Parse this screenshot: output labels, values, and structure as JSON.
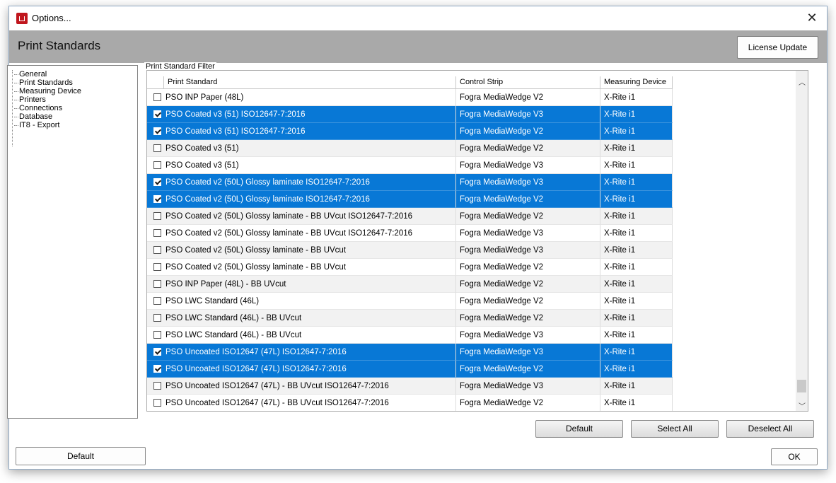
{
  "window": {
    "title": "Options...",
    "close_glyph": "✕"
  },
  "header": {
    "title": "Print Standards",
    "license_button": "License Update"
  },
  "tree": {
    "items": [
      "General",
      "Print Standards",
      "Measuring Device",
      "Printers",
      "Connections",
      "Database",
      "IT8 - Export"
    ]
  },
  "filter": {
    "legend": "Print Standard Filter",
    "columns": {
      "standard": "Print Standard",
      "strip": "Control Strip",
      "device": "Measuring Device"
    },
    "rows": [
      {
        "checked": false,
        "selected": false,
        "standard": "PSO INP Paper (48L)",
        "strip": "Fogra MediaWedge V2",
        "device": "X-Rite i1"
      },
      {
        "checked": true,
        "selected": true,
        "standard": "PSO Coated v3 (51) ISO12647-7:2016",
        "strip": "Fogra MediaWedge V3",
        "device": "X-Rite i1"
      },
      {
        "checked": true,
        "selected": true,
        "standard": "PSO Coated v3 (51) ISO12647-7:2016",
        "strip": "Fogra MediaWedge V2",
        "device": "X-Rite i1"
      },
      {
        "checked": false,
        "selected": false,
        "standard": "PSO Coated v3 (51)",
        "strip": "Fogra MediaWedge V2",
        "device": "X-Rite i1"
      },
      {
        "checked": false,
        "selected": false,
        "standard": "PSO Coated v3 (51)",
        "strip": "Fogra MediaWedge V3",
        "device": "X-Rite i1"
      },
      {
        "checked": true,
        "selected": true,
        "standard": "PSO Coated v2 (50L) Glossy laminate ISO12647-7:2016",
        "strip": "Fogra MediaWedge V3",
        "device": "X-Rite i1"
      },
      {
        "checked": true,
        "selected": true,
        "standard": "PSO Coated v2 (50L) Glossy laminate ISO12647-7:2016",
        "strip": "Fogra MediaWedge V2",
        "device": "X-Rite i1"
      },
      {
        "checked": false,
        "selected": false,
        "standard": "PSO Coated v2 (50L) Glossy laminate - BB UVcut ISO12647-7:2016",
        "strip": "Fogra MediaWedge V2",
        "device": "X-Rite i1"
      },
      {
        "checked": false,
        "selected": false,
        "standard": "PSO Coated v2 (50L) Glossy laminate - BB UVcut ISO12647-7:2016",
        "strip": "Fogra MediaWedge V3",
        "device": "X-Rite i1"
      },
      {
        "checked": false,
        "selected": false,
        "standard": "PSO Coated v2 (50L) Glossy laminate - BB UVcut",
        "strip": "Fogra MediaWedge V3",
        "device": "X-Rite i1"
      },
      {
        "checked": false,
        "selected": false,
        "standard": "PSO Coated v2 (50L) Glossy laminate - BB UVcut",
        "strip": "Fogra MediaWedge V2",
        "device": "X-Rite i1"
      },
      {
        "checked": false,
        "selected": false,
        "standard": "PSO INP Paper (48L) - BB UVcut",
        "strip": "Fogra MediaWedge V2",
        "device": "X-Rite i1"
      },
      {
        "checked": false,
        "selected": false,
        "standard": "PSO LWC Standard (46L)",
        "strip": "Fogra MediaWedge V2",
        "device": "X-Rite i1"
      },
      {
        "checked": false,
        "selected": false,
        "standard": "PSO LWC Standard (46L) - BB UVcut",
        "strip": "Fogra MediaWedge V2",
        "device": "X-Rite i1"
      },
      {
        "checked": false,
        "selected": false,
        "standard": "PSO LWC Standard (46L) - BB UVcut",
        "strip": "Fogra MediaWedge V3",
        "device": "X-Rite i1"
      },
      {
        "checked": true,
        "selected": true,
        "standard": "PSO Uncoated ISO12647 (47L) ISO12647-7:2016",
        "strip": "Fogra MediaWedge V3",
        "device": "X-Rite i1"
      },
      {
        "checked": true,
        "selected": true,
        "standard": "PSO Uncoated ISO12647 (47L) ISO12647-7:2016",
        "strip": "Fogra MediaWedge V2",
        "device": "X-Rite i1"
      },
      {
        "checked": false,
        "selected": false,
        "standard": "PSO Uncoated ISO12647 (47L) - BB UVcut ISO12647-7:2016",
        "strip": "Fogra MediaWedge V3",
        "device": "X-Rite i1"
      },
      {
        "checked": false,
        "selected": false,
        "standard": "PSO Uncoated ISO12647 (47L) - BB UVcut ISO12647-7:2016",
        "strip": "Fogra MediaWedge V2",
        "device": "X-Rite i1"
      }
    ],
    "buttons": {
      "default": "Default",
      "select_all": "Select All",
      "deselect_all": "Deselect All"
    }
  },
  "footer": {
    "default": "Default",
    "ok": "OK"
  },
  "colors": {
    "selection": "#0878d6",
    "header_bar": "#a9a9a9"
  },
  "icons": {
    "app": "app-logo-icon",
    "close": "close-icon",
    "scroll_up": "chevron-up-icon",
    "scroll_down": "chevron-down-icon"
  }
}
